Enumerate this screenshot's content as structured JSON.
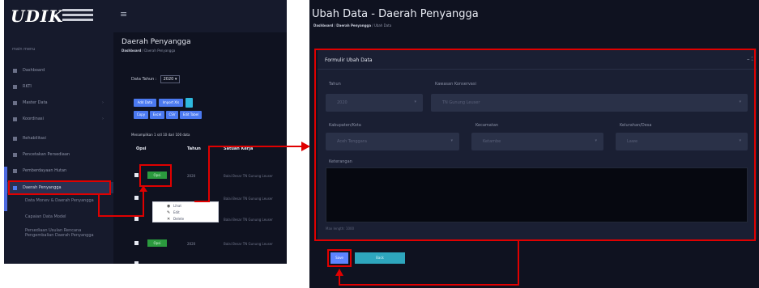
{
  "left_panel": {
    "logo": "UDIK",
    "hamburger": "≡",
    "sidebar_heading": "main menu",
    "nav_items": [
      {
        "label": "Dashboard",
        "chevron": ""
      },
      {
        "label": "RKTI",
        "chevron": ""
      },
      {
        "label": "Master Data",
        "chevron": "›"
      },
      {
        "label": "Koordinasi",
        "chevron": "›"
      },
      {
        "label": "Rehabilitasi",
        "chevron": ""
      },
      {
        "label": "Pencetakan Persediaan",
        "chevron": ""
      },
      {
        "label": "Pemberdayaan Hutan",
        "chevron": ""
      },
      {
        "label": "Daerah Penyangga",
        "chevron": ""
      }
    ],
    "sub_items": [
      "Data Monev & Daerah Penyangga",
      "Capaian Data Model",
      "Persediaan Usulan Rencana Pengembalian Daerah Penyangga"
    ],
    "page_title": "Daerah Penyangga",
    "breadcrumb_home": "Dashboard",
    "breadcrumb_current": "Daerah Penyangga",
    "filter_label": "Data Tahun :",
    "filter_value": "2020 ▾",
    "buttons": [
      "Add Data",
      "Import Xls",
      "Copy",
      "Excel",
      "CSV",
      "Edit Tabel"
    ],
    "showing_text": "Menampilkan 1 s/d 10 dari 100 data",
    "table_headers": {
      "aksi": "Opsi",
      "tahun": "Tahun",
      "kerja": "Satuan Kerja"
    },
    "rows": [
      {
        "action": "Opsi",
        "year": "2020",
        "kerja": "Balai Besar TN Gunung Leuser"
      },
      {
        "action": "",
        "year": "",
        "kerja": "Balai Besar TN Gunung Leuser"
      },
      {
        "action": "",
        "year": "",
        "kerja": "Balai Besar TN Gunung Leuser"
      },
      {
        "action": "Opsi",
        "year": "2020",
        "kerja": "Balai Besar TN Gunung Leuser"
      }
    ],
    "dropdown_menu": [
      {
        "icon": "◉",
        "label": "Lihat"
      },
      {
        "icon": "✎",
        "label": "Edit"
      },
      {
        "icon": "✕",
        "label": "Delete"
      }
    ]
  },
  "right_panel": {
    "title": "Ubah Data - Daerah Penyangga",
    "breadcrumb_home": "Dashboard",
    "breadcrumb_mid": "Daerah Penyangga",
    "breadcrumb_current": "Ubah Data",
    "card_title": "Formulir Ubah Data",
    "card_tools": "– ⛶",
    "labels": {
      "tahun": "Tahun",
      "kawasan": "Kawasan Konservasi",
      "kabupaten": "Kabupaten/Kota",
      "kecamatan": "Kecamatan",
      "desa": "Kelurahan/Desa",
      "keterangan": "Keterangan"
    },
    "values": {
      "tahun": "2020",
      "kawasan": "TN Gunung Leuser",
      "kabupaten": "Aceh Tenggara",
      "kecamatan": "Ketambe",
      "desa": "Lawe"
    },
    "hint": "Max length: 1000",
    "save_label": "Save",
    "back_label": "Back",
    "dropdown_caret": "▾"
  },
  "annotation_color": "#e00000"
}
